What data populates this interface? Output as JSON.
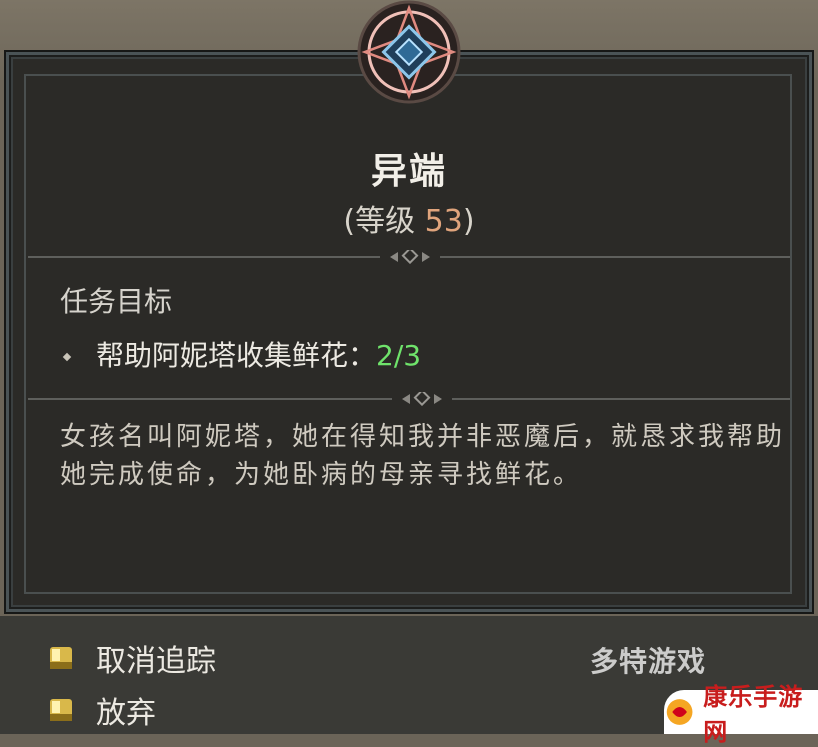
{
  "quest": {
    "title": "异端",
    "level_prefix": "(等级 ",
    "level": "53",
    "level_suffix": ")"
  },
  "objectives": {
    "header": "任务目标",
    "items": [
      {
        "text": "帮助阿妮塔收集鲜花：",
        "progress": "2/3"
      }
    ]
  },
  "description": "女孩名叫阿妮塔，她在得知我并非恶魔后，就恳求我帮助她完成使命，为她卧病的母亲寻找鲜花。",
  "actions": {
    "untrack": "取消追踪",
    "abandon": "放弃"
  },
  "watermarks": {
    "brand_text": "多特游戏",
    "site_text": "康乐手游网"
  },
  "colors": {
    "progress": "#6fe36b",
    "level": "#e0a47c",
    "panel": "#2b2a27"
  }
}
